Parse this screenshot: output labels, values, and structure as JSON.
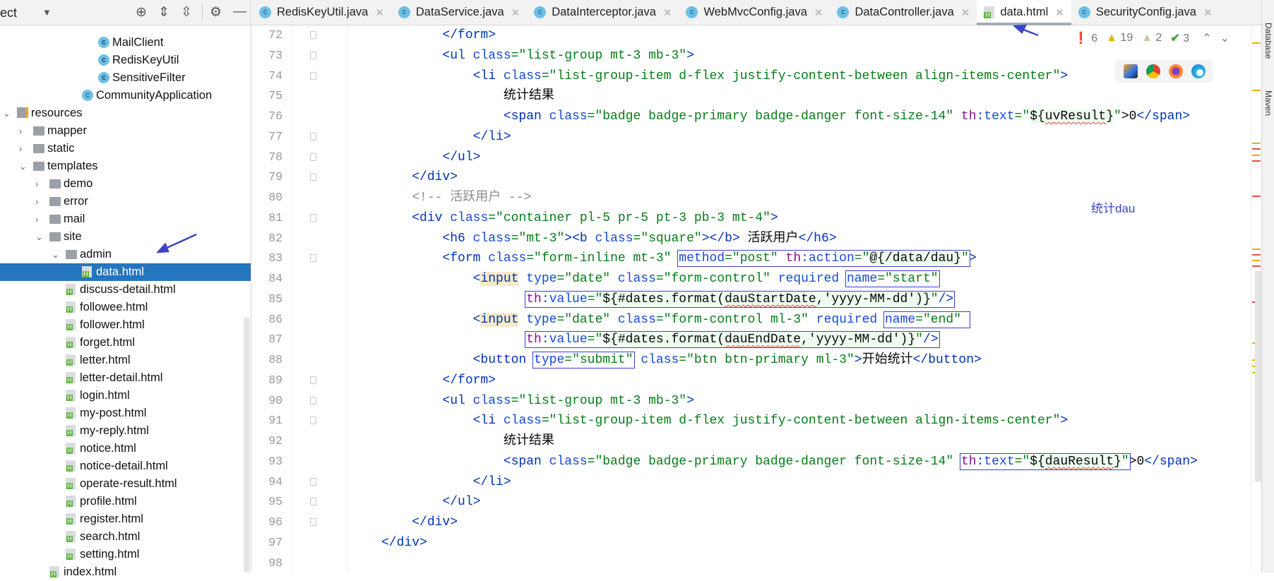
{
  "project_panel": {
    "title": "ect",
    "dropdown_icon": "caret-down-icon",
    "toolbar_icons": [
      "locate-icon",
      "expand-all-icon",
      "collapse-all-icon",
      "gear-icon",
      "minimize-icon"
    ],
    "items": [
      {
        "label": "MailClient",
        "type": "class",
        "depth": 5
      },
      {
        "label": "RedisKeyUtil",
        "type": "class",
        "depth": 5
      },
      {
        "label": "SensitiveFilter",
        "type": "class",
        "depth": 5
      },
      {
        "label": "CommunityApplication",
        "type": "app",
        "depth": 4
      },
      {
        "label": "resources",
        "type": "res",
        "depth": 0,
        "expanded": true
      },
      {
        "label": "mapper",
        "type": "folder",
        "depth": 1,
        "expanded": false
      },
      {
        "label": "static",
        "type": "folder",
        "depth": 1,
        "expanded": false
      },
      {
        "label": "templates",
        "type": "folder",
        "depth": 1,
        "expanded": true
      },
      {
        "label": "demo",
        "type": "folder",
        "depth": 2,
        "expanded": false
      },
      {
        "label": "error",
        "type": "folder",
        "depth": 2,
        "expanded": false
      },
      {
        "label": "mail",
        "type": "folder",
        "depth": 2,
        "expanded": false
      },
      {
        "label": "site",
        "type": "folder",
        "depth": 2,
        "expanded": true
      },
      {
        "label": "admin",
        "type": "folder",
        "depth": 3,
        "expanded": true
      },
      {
        "label": "data.html",
        "type": "html",
        "depth": 4,
        "selected": true
      },
      {
        "label": "discuss-detail.html",
        "type": "html",
        "depth": 3
      },
      {
        "label": "followee.html",
        "type": "html",
        "depth": 3
      },
      {
        "label": "follower.html",
        "type": "html",
        "depth": 3
      },
      {
        "label": "forget.html",
        "type": "html",
        "depth": 3
      },
      {
        "label": "letter.html",
        "type": "html",
        "depth": 3
      },
      {
        "label": "letter-detail.html",
        "type": "html",
        "depth": 3
      },
      {
        "label": "login.html",
        "type": "html",
        "depth": 3
      },
      {
        "label": "my-post.html",
        "type": "html",
        "depth": 3
      },
      {
        "label": "my-reply.html",
        "type": "html",
        "depth": 3
      },
      {
        "label": "notice.html",
        "type": "html",
        "depth": 3
      },
      {
        "label": "notice-detail.html",
        "type": "html",
        "depth": 3
      },
      {
        "label": "operate-result.html",
        "type": "html",
        "depth": 3
      },
      {
        "label": "profile.html",
        "type": "html",
        "depth": 3
      },
      {
        "label": "register.html",
        "type": "html",
        "depth": 3
      },
      {
        "label": "search.html",
        "type": "html",
        "depth": 3
      },
      {
        "label": "setting.html",
        "type": "html",
        "depth": 3
      },
      {
        "label": "index.html",
        "type": "html",
        "depth": 2
      }
    ]
  },
  "tabs": [
    {
      "label": "RedisKeyUtil.java",
      "type": "class"
    },
    {
      "label": "DataService.java",
      "type": "class"
    },
    {
      "label": "DataInterceptor.java",
      "type": "class"
    },
    {
      "label": "WebMvcConfig.java",
      "type": "class"
    },
    {
      "label": "DataController.java",
      "type": "class"
    },
    {
      "label": "data.html",
      "type": "html",
      "active": true
    },
    {
      "label": "SecurityConfig.java",
      "type": "class"
    }
  ],
  "inspections": {
    "errors": "6",
    "warnings": "19",
    "weak_warnings": "2",
    "typos": "3"
  },
  "browser_icons": [
    "intellij-icon",
    "chrome-icon",
    "firefox-icon",
    "edge-icon"
  ],
  "annotation": "统计dau",
  "right_tools": [
    "Database",
    "Maven"
  ],
  "colors": {
    "selection": "#2675bf",
    "annotation": "#3a44c8",
    "error": "#d73b3b",
    "warning": "#e7b400"
  },
  "code": [
    {
      "n": "72",
      "indent": 8,
      "tokens": [
        {
          "t": "</form>",
          "k": "tag"
        }
      ]
    },
    {
      "n": "73",
      "indent": 8,
      "tokens": [
        {
          "t": "<ul ",
          "k": "tag"
        },
        {
          "t": "class",
          "k": "attr"
        },
        {
          "t": "=\"list-group mt-3 mb-3\"",
          "k": "val"
        },
        {
          "t": ">",
          "k": "tag"
        }
      ]
    },
    {
      "n": "74",
      "indent": 12,
      "tokens": [
        {
          "t": "<li ",
          "k": "tag"
        },
        {
          "t": "class",
          "k": "attr"
        },
        {
          "t": "=\"list-group-item d-flex justify-content-between align-items-center\"",
          "k": "val"
        },
        {
          "t": ">",
          "k": "tag"
        }
      ]
    },
    {
      "n": "75",
      "indent": 16,
      "tokens": [
        {
          "t": "统计结果",
          "k": "text"
        }
      ]
    },
    {
      "n": "76",
      "indent": 16,
      "tokens": [
        {
          "t": "<span ",
          "k": "tag"
        },
        {
          "t": "class",
          "k": "attr"
        },
        {
          "t": "=\"badge badge-primary badge-danger font-size-14\" ",
          "k": "val"
        },
        {
          "t": "th",
          "k": "th"
        },
        {
          "t": ":text",
          "k": "attr"
        },
        {
          "t": "=\"",
          "k": "val"
        },
        {
          "t": "${",
          "k": "expr"
        },
        {
          "t": "uvResult",
          "k": "expr",
          "sq": true
        },
        {
          "t": "}",
          "k": "expr"
        },
        {
          "t": "\"",
          "k": "val"
        },
        {
          "t": ">0",
          "k": "text"
        },
        {
          "t": "</span>",
          "k": "tag"
        }
      ]
    },
    {
      "n": "77",
      "indent": 12,
      "tokens": [
        {
          "t": "</li>",
          "k": "tag"
        }
      ]
    },
    {
      "n": "78",
      "indent": 8,
      "tokens": [
        {
          "t": "</ul>",
          "k": "tag"
        }
      ]
    },
    {
      "n": "79",
      "indent": 4,
      "tokens": [
        {
          "t": "</div>",
          "k": "tag"
        }
      ]
    },
    {
      "n": "80",
      "indent": 4,
      "tokens": [
        {
          "t": "<!-- 活跃用户 -->",
          "k": "com"
        }
      ]
    },
    {
      "n": "81",
      "indent": 4,
      "tokens": [
        {
          "t": "<div ",
          "k": "tag"
        },
        {
          "t": "class",
          "k": "attr"
        },
        {
          "t": "=\"container pl-5 pr-5 pt-3 pb-3 mt-4\"",
          "k": "val"
        },
        {
          "t": ">",
          "k": "tag"
        }
      ]
    },
    {
      "n": "82",
      "indent": 8,
      "tokens": [
        {
          "t": "<h6 ",
          "k": "tag"
        },
        {
          "t": "class",
          "k": "attr"
        },
        {
          "t": "=\"mt-3\"",
          "k": "val"
        },
        {
          "t": "><b ",
          "k": "tag"
        },
        {
          "t": "class",
          "k": "attr"
        },
        {
          "t": "=\"square\"",
          "k": "val"
        },
        {
          "t": "></b>",
          "k": "tag"
        },
        {
          "t": " 活跃用户",
          "k": "text"
        },
        {
          "t": "</h6>",
          "k": "tag"
        }
      ]
    },
    {
      "n": "83",
      "indent": 8,
      "tokens": [
        {
          "t": "<form ",
          "k": "tag"
        },
        {
          "t": "class",
          "k": "attr"
        },
        {
          "t": "=\"form-inline mt-3\" ",
          "k": "val"
        },
        {
          "t": "method",
          "k": "attr",
          "box": 1
        },
        {
          "t": "=\"post\" ",
          "k": "val",
          "box": 1
        },
        {
          "t": "th",
          "k": "th",
          "box": 1
        },
        {
          "t": ":action",
          "k": "attr",
          "box": 1
        },
        {
          "t": "=\"",
          "k": "val",
          "box": 1
        },
        {
          "t": "@{/data/dau}",
          "k": "expr",
          "box": 1
        },
        {
          "t": "\"",
          "k": "val",
          "box": 1
        },
        {
          "t": ">",
          "k": "tag"
        }
      ]
    },
    {
      "n": "84",
      "indent": 12,
      "tokens": [
        {
          "t": "<",
          "k": "tag"
        },
        {
          "t": "input",
          "k": "tagbg"
        },
        {
          "t": " ",
          "k": "text"
        },
        {
          "t": "type",
          "k": "attr"
        },
        {
          "t": "=\"date\" ",
          "k": "val"
        },
        {
          "t": "class",
          "k": "attr"
        },
        {
          "t": "=\"form-control\" ",
          "k": "val"
        },
        {
          "t": "required ",
          "k": "attr"
        },
        {
          "t": "name",
          "k": "attr",
          "box": 2
        },
        {
          "t": "=\"start\"",
          "k": "val",
          "box": 2
        }
      ]
    },
    {
      "n": "85",
      "indent": 19,
      "tokens": [
        {
          "t": "th",
          "k": "th",
          "box": 3
        },
        {
          "t": ":value",
          "k": "attr",
          "box": 3
        },
        {
          "t": "=\"",
          "k": "val",
          "box": 3
        },
        {
          "t": "${#dates.format(",
          "k": "expr",
          "box": 3
        },
        {
          "t": "dauStartDate",
          "k": "expr",
          "sq": true,
          "box": 3
        },
        {
          "t": ",'yyyy-MM-dd')}",
          "k": "expr",
          "box": 3
        },
        {
          "t": "\"",
          "k": "val",
          "box": 3
        },
        {
          "t": "/>",
          "k": "tag",
          "box": 3
        }
      ]
    },
    {
      "n": "86",
      "indent": 12,
      "tokens": [
        {
          "t": "<",
          "k": "tag"
        },
        {
          "t": "input",
          "k": "tagbg"
        },
        {
          "t": " ",
          "k": "text"
        },
        {
          "t": "type",
          "k": "attr"
        },
        {
          "t": "=\"date\" ",
          "k": "val"
        },
        {
          "t": "class",
          "k": "attr"
        },
        {
          "t": "=\"form-control ml-3\" ",
          "k": "val"
        },
        {
          "t": "required ",
          "k": "attr"
        },
        {
          "t": "name",
          "k": "attr",
          "box": 4
        },
        {
          "t": "=\"end\" ",
          "k": "val",
          "box": 4
        }
      ]
    },
    {
      "n": "87",
      "indent": 19,
      "tokens": [
        {
          "t": "th",
          "k": "th",
          "box": 5
        },
        {
          "t": ":value",
          "k": "attr",
          "box": 5
        },
        {
          "t": "=\"",
          "k": "val",
          "box": 5
        },
        {
          "t": "${#dates.format(",
          "k": "expr",
          "box": 5
        },
        {
          "t": "dauEndDate",
          "k": "expr",
          "sq": true,
          "box": 5
        },
        {
          "t": ",'yyyy-MM-dd')}",
          "k": "expr",
          "box": 5
        },
        {
          "t": "\"",
          "k": "val",
          "box": 5
        },
        {
          "t": "/>",
          "k": "tag",
          "box": 5
        }
      ]
    },
    {
      "n": "88",
      "indent": 12,
      "tokens": [
        {
          "t": "<button",
          "k": "tag"
        },
        {
          "t": " ",
          "k": "text"
        },
        {
          "t": "type",
          "k": "attr",
          "box": 6
        },
        {
          "t": "=\"submit\"",
          "k": "val",
          "box": 6
        },
        {
          "t": " ",
          "k": "text"
        },
        {
          "t": "class",
          "k": "attr"
        },
        {
          "t": "=\"btn btn-primary ml-3\"",
          "k": "val"
        },
        {
          "t": ">",
          "k": "tag"
        },
        {
          "t": "开始统计",
          "k": "text"
        },
        {
          "t": "</button>",
          "k": "tag"
        }
      ]
    },
    {
      "n": "89",
      "indent": 8,
      "tokens": [
        {
          "t": "</form>",
          "k": "tag"
        }
      ]
    },
    {
      "n": "90",
      "indent": 8,
      "tokens": [
        {
          "t": "<ul ",
          "k": "tag"
        },
        {
          "t": "class",
          "k": "attr"
        },
        {
          "t": "=\"list-group mt-3 mb-3\"",
          "k": "val"
        },
        {
          "t": ">",
          "k": "tag"
        }
      ]
    },
    {
      "n": "91",
      "indent": 12,
      "tokens": [
        {
          "t": "<li ",
          "k": "tag"
        },
        {
          "t": "class",
          "k": "attr"
        },
        {
          "t": "=\"list-group-item d-flex justify-content-between align-items-center\"",
          "k": "val"
        },
        {
          "t": ">",
          "k": "tag"
        }
      ]
    },
    {
      "n": "92",
      "indent": 16,
      "tokens": [
        {
          "t": "统计结果",
          "k": "text"
        }
      ]
    },
    {
      "n": "93",
      "indent": 16,
      "tokens": [
        {
          "t": "<span ",
          "k": "tag"
        },
        {
          "t": "class",
          "k": "attr"
        },
        {
          "t": "=\"badge badge-primary badge-danger font-size-14\" ",
          "k": "val"
        },
        {
          "t": "th",
          "k": "th",
          "box": 7
        },
        {
          "t": ":text",
          "k": "attr",
          "box": 7
        },
        {
          "t": "=\"",
          "k": "val",
          "box": 7
        },
        {
          "t": "${",
          "k": "expr",
          "box": 7
        },
        {
          "t": "dauResult",
          "k": "expr",
          "sq": true,
          "box": 7
        },
        {
          "t": "}",
          "k": "expr",
          "box": 7
        },
        {
          "t": "\"",
          "k": "val",
          "box": 7
        },
        {
          "t": ">0",
          "k": "text"
        },
        {
          "t": "</span>",
          "k": "tag"
        }
      ]
    },
    {
      "n": "94",
      "indent": 12,
      "tokens": [
        {
          "t": "</li>",
          "k": "tag"
        }
      ]
    },
    {
      "n": "95",
      "indent": 8,
      "tokens": [
        {
          "t": "</ul>",
          "k": "tag"
        }
      ]
    },
    {
      "n": "96",
      "indent": 4,
      "tokens": [
        {
          "t": "</div>",
          "k": "tag"
        }
      ]
    },
    {
      "n": "97",
      "indent": 0,
      "tokens": [
        {
          "t": "</div>",
          "k": "tag"
        }
      ]
    },
    {
      "n": "98",
      "indent": 0,
      "tokens": []
    }
  ]
}
